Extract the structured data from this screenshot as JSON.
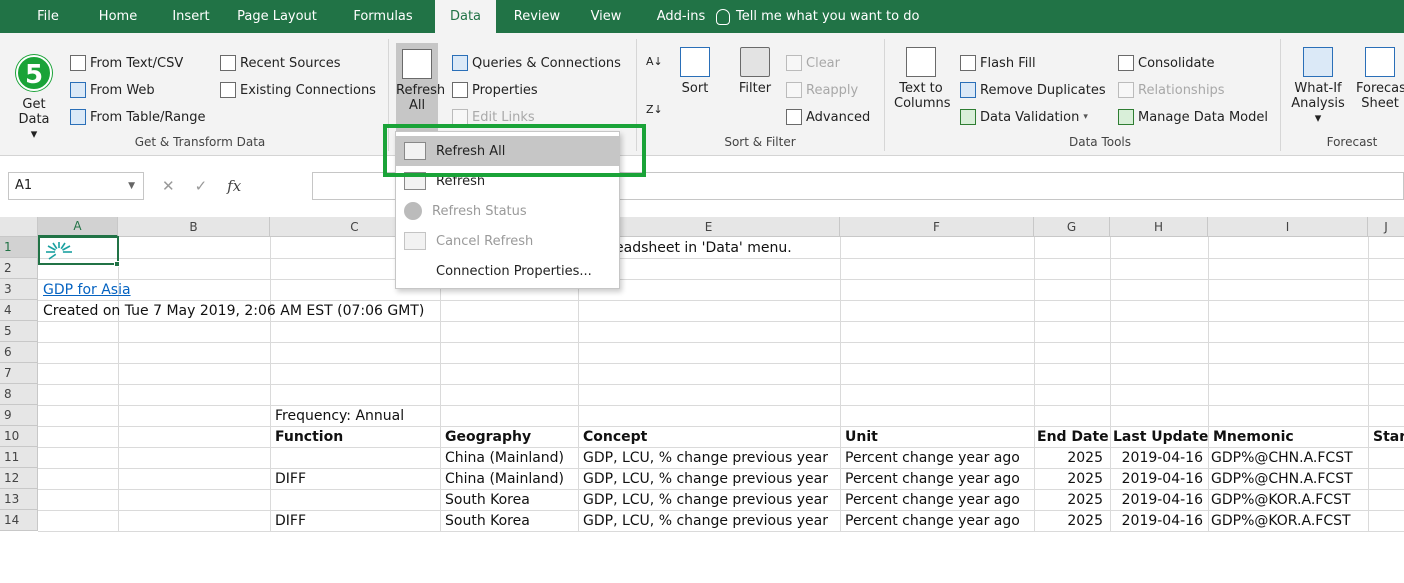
{
  "ribbon_tabs": [
    "File",
    "Home",
    "Insert",
    "Page Layout",
    "Formulas",
    "Data",
    "Review",
    "View",
    "Add-ins"
  ],
  "tell_me": "Tell me what you want to do",
  "step_badge": "5",
  "get_transform": {
    "get_data": "Get",
    "get_data2": "Data",
    "from_text": "From Text/CSV",
    "from_web": "From Web",
    "from_table": "From Table/Range",
    "recent_sources": "Recent Sources",
    "existing_connections": "Existing Connections",
    "label": "Get & Transform Data"
  },
  "queries": {
    "refresh_all_top": "Refresh",
    "refresh_all_bottom": "All",
    "queries_connections": "Queries & Connections",
    "properties": "Properties",
    "edit_links": "Edit Links"
  },
  "sort_filter": {
    "sort": "Sort",
    "filter": "Filter",
    "clear": "Clear",
    "reapply": "Reapply",
    "advanced": "Advanced",
    "label": "Sort & Filter"
  },
  "data_tools": {
    "text_to_1": "Text to",
    "text_to_2": "Columns",
    "flash_fill": "Flash Fill",
    "remove_duplicates": "Remove Duplicates",
    "data_validation": "Data Validation",
    "consolidate": "Consolidate",
    "relationships": "Relationships",
    "manage_model": "Manage Data Model",
    "label": "Data Tools"
  },
  "forecast": {
    "whatif_1": "What-If",
    "whatif_2": "Analysis",
    "sheet_1": "Forecast",
    "sheet_2": "Sheet",
    "label": "Forecast"
  },
  "refresh_menu": {
    "items": [
      "Refresh All",
      "Refresh",
      "Refresh Status",
      "Cancel Refresh",
      "Connection Properties..."
    ]
  },
  "formula_bar": {
    "name_box": "A1",
    "fx": "fx"
  },
  "columns": [
    "A",
    "B",
    "C",
    "D",
    "E",
    "F",
    "G",
    "H",
    "I",
    "J"
  ],
  "col_J_partial": "Start",
  "rows": [
    "1",
    "2",
    "3",
    "4",
    "5",
    "6",
    "7",
    "8",
    "9",
    "10",
    "11",
    "12",
    "13",
    "14"
  ],
  "sheet": {
    "e1": "eadsheet in 'Data' menu.",
    "a3": "GDP for Asia",
    "a4": "Created on Tue 7 May 2019, 2:06 AM EST (07:06 GMT)",
    "c9": "Frequency: Annual",
    "headers": {
      "function": "Function",
      "geography": "Geography",
      "concept": "Concept",
      "unit": "Unit",
      "end_date": "End Date",
      "last_update": "Last Update",
      "mnemonic": "Mnemonic",
      "start": "Start"
    },
    "data_rows": [
      {
        "function": "",
        "geography": "China (Mainland)",
        "concept": "GDP, LCU, % change previous year",
        "unit": "Percent change year ago",
        "end_date": "2025",
        "last_update": "2019-04-16",
        "mnemonic": "GDP%@CHN.A.FCST"
      },
      {
        "function": "DIFF",
        "geography": "China (Mainland)",
        "concept": "GDP, LCU, % change previous year",
        "unit": "Percent change year ago",
        "end_date": "2025",
        "last_update": "2019-04-16",
        "mnemonic": "GDP%@CHN.A.FCST"
      },
      {
        "function": "",
        "geography": "South Korea",
        "concept": "GDP, LCU, % change previous year",
        "unit": "Percent change year ago",
        "end_date": "2025",
        "last_update": "2019-04-16",
        "mnemonic": "GDP%@KOR.A.FCST"
      },
      {
        "function": "DIFF",
        "geography": "South Korea",
        "concept": "GDP, LCU, % change previous year",
        "unit": "Percent change year ago",
        "end_date": "2025",
        "last_update": "2019-04-16",
        "mnemonic": "GDP%@KOR.A.FCST"
      }
    ]
  },
  "colors": {
    "excel_green": "#217346",
    "highlight_green": "#1aa338",
    "link_blue": "#0563c1"
  }
}
